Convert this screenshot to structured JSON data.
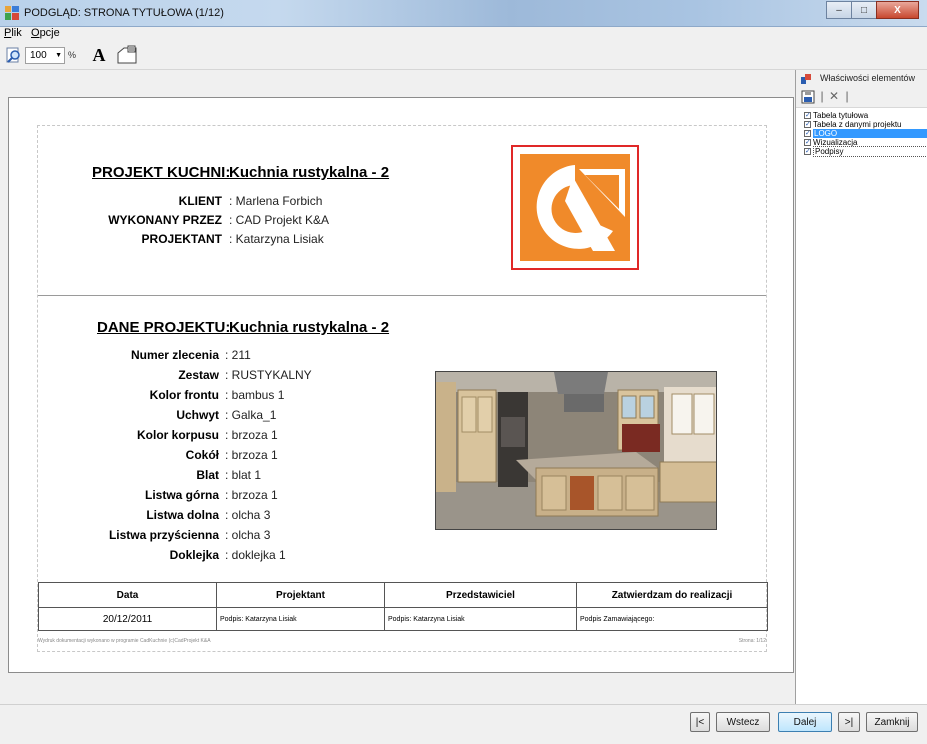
{
  "window": {
    "title": "PODGLĄD: STRONA TYTUŁOWA (1/12)",
    "controls": {
      "minimize": "–",
      "maximize": "□",
      "close": "X"
    }
  },
  "menu": {
    "items": [
      {
        "label": "Plik",
        "accel": "P",
        "rest": "lik"
      },
      {
        "label": "Opcje",
        "accel": "O",
        "rest": "pcje"
      }
    ]
  },
  "toolbar": {
    "zoom_value": "100",
    "zoom_unit": "%",
    "font_label": "A"
  },
  "page": {
    "project_heading": "PROJEKT KUCHNI:",
    "project_name": "Kuchnia rustykalna - 2",
    "client_info": [
      {
        "label": "KLIENT",
        "value": ": Marlena Forbich"
      },
      {
        "label": "WYKONANY PRZEZ",
        "value": ": CAD Projekt K&A"
      },
      {
        "label": "PROJEKTANT",
        "value": ": Katarzyna Lisiak"
      }
    ],
    "data_heading": "DANE PROJEKTU:",
    "data_name": "Kuchnia rustykalna - 2",
    "details": [
      {
        "label": "Numer zlecenia",
        "value": ": 211"
      },
      {
        "label": "Zestaw",
        "value": ": RUSTYKALNY"
      },
      {
        "label": "Kolor frontu",
        "value": ": bambus 1"
      },
      {
        "label": "Uchwyt",
        "value": ": Galka_1"
      },
      {
        "label": "Kolor korpusu",
        "value": ": brzoza 1"
      },
      {
        "label": "Cokół",
        "value": ": brzoza 1"
      },
      {
        "label": "Blat",
        "value": ": blat 1"
      },
      {
        "label": "Listwa górna",
        "value": ": brzoza 1"
      },
      {
        "label": "Listwa dolna",
        "value": ": olcha 3"
      },
      {
        "label": "Listwa przyścienna",
        "value": ": olcha 3"
      },
      {
        "label": "Doklejka",
        "value": ": doklejka 1"
      }
    ],
    "signature_table": {
      "headers": [
        "Data",
        "Projektant",
        "Przedstawiciel",
        "Zatwierdzam do realizacji"
      ],
      "row": [
        "20/12/2011",
        "Podpis: Katarzyna Lisiak",
        "Podpis: Katarzyna Lisiak",
        "Podpis Zamawiającego:"
      ]
    },
    "footer_left": "Wydruk dokumentacji wykonano w programie CadKuchnie (c)CadProjekt K&A",
    "footer_right": "Strona: 1/12"
  },
  "side_panel": {
    "title": "Właściwości elementów",
    "items": [
      {
        "label": "Tabela tytułowa",
        "checked": true,
        "state": "normal"
      },
      {
        "label": "Tabela z danymi projektu",
        "checked": true,
        "state": "normal"
      },
      {
        "label": "LOGO",
        "checked": true,
        "state": "selected"
      },
      {
        "label": "Wizualizacja",
        "checked": true,
        "state": "normal"
      },
      {
        "label": "Podpisy",
        "checked": true,
        "state": "focused"
      }
    ]
  },
  "buttons": {
    "first": "|<",
    "back": "Wstecz",
    "next": "Dalej",
    "last": ">|",
    "close": "Zamknij"
  },
  "colors": {
    "logo_orange": "#f08a2a",
    "logo_frame": "#e02828",
    "selection_blue": "#3399ff"
  }
}
